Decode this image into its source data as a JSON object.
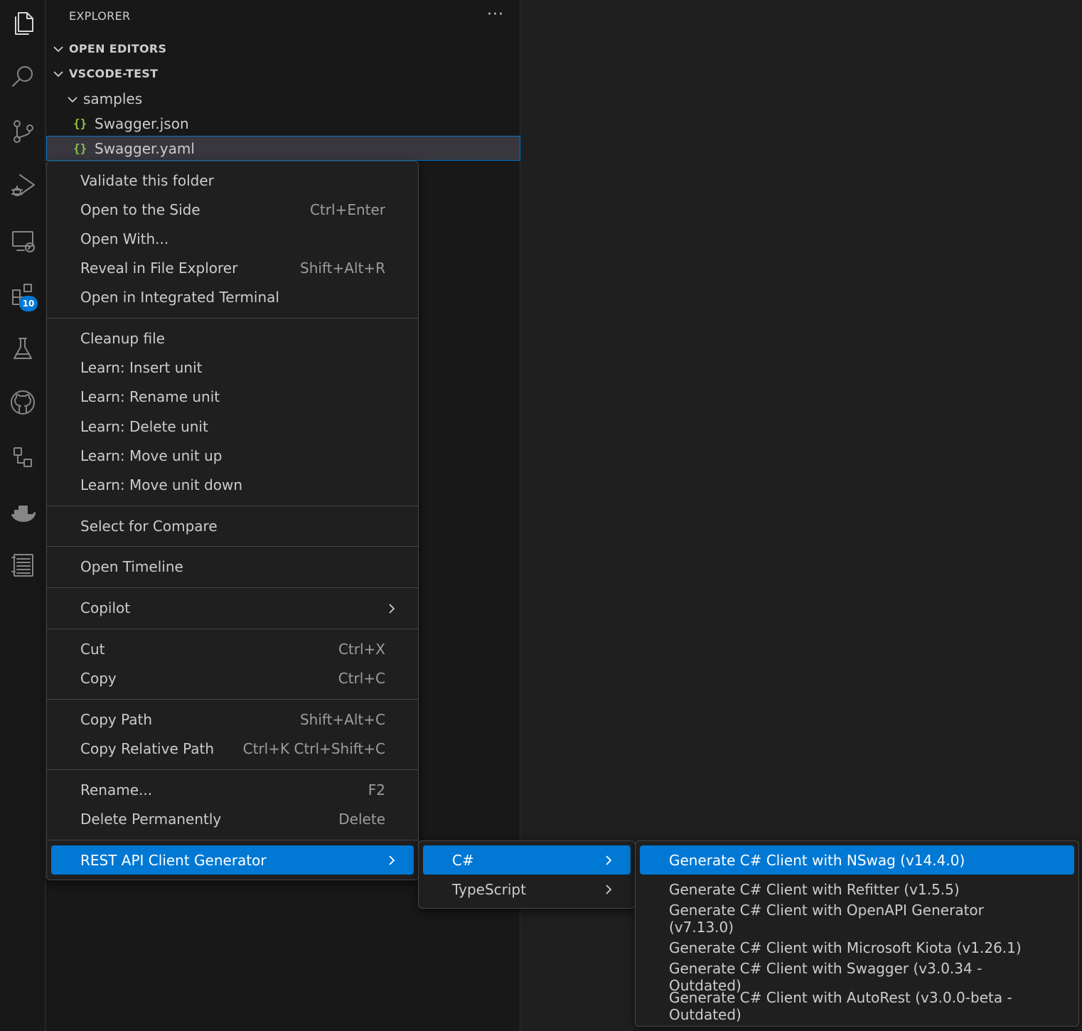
{
  "sidebar": {
    "title": "EXPLORER",
    "more": "···",
    "open_editors": "OPEN EDITORS",
    "workspace": "VSCODE-TEST",
    "folder": "samples",
    "files": [
      {
        "icon": "{}",
        "name": "Swagger.json"
      },
      {
        "icon": "{}",
        "name": "Swagger.yaml"
      }
    ]
  },
  "activity_bar": {
    "extensions_badge": "10"
  },
  "context_menu": {
    "groups": [
      [
        {
          "label": "Validate this folder",
          "shortcut": ""
        },
        {
          "label": "Open to the Side",
          "shortcut": "Ctrl+Enter"
        },
        {
          "label": "Open With...",
          "shortcut": ""
        },
        {
          "label": "Reveal in File Explorer",
          "shortcut": "Shift+Alt+R"
        },
        {
          "label": "Open in Integrated Terminal",
          "shortcut": ""
        }
      ],
      [
        {
          "label": "Cleanup file",
          "shortcut": ""
        },
        {
          "label": "Learn: Insert unit",
          "shortcut": ""
        },
        {
          "label": "Learn: Rename unit",
          "shortcut": ""
        },
        {
          "label": "Learn: Delete unit",
          "shortcut": ""
        },
        {
          "label": "Learn: Move unit up",
          "shortcut": ""
        },
        {
          "label": "Learn: Move unit down",
          "shortcut": ""
        }
      ],
      [
        {
          "label": "Select for Compare",
          "shortcut": ""
        }
      ],
      [
        {
          "label": "Open Timeline",
          "shortcut": ""
        }
      ],
      [
        {
          "label": "Copilot",
          "shortcut": ""
        }
      ],
      [
        {
          "label": "Cut",
          "shortcut": "Ctrl+X"
        },
        {
          "label": "Copy",
          "shortcut": "Ctrl+C"
        }
      ],
      [
        {
          "label": "Copy Path",
          "shortcut": "Shift+Alt+C"
        },
        {
          "label": "Copy Relative Path",
          "shortcut": "Ctrl+K Ctrl+Shift+C"
        }
      ],
      [
        {
          "label": "Rename...",
          "shortcut": "F2"
        },
        {
          "label": "Delete Permanently",
          "shortcut": "Delete"
        }
      ],
      [
        {
          "label": "REST API Client Generator",
          "shortcut": ""
        }
      ]
    ]
  },
  "submenu_language": {
    "items": [
      {
        "label": "C#"
      },
      {
        "label": "TypeScript"
      }
    ]
  },
  "submenu_csharp": {
    "items": [
      {
        "label": "Generate C# Client with NSwag (v14.4.0)"
      },
      {
        "label": "Generate C# Client with Refitter (v1.5.5)"
      },
      {
        "label": "Generate C# Client with OpenAPI Generator (v7.13.0)"
      },
      {
        "label": "Generate C# Client with Microsoft Kiota (v1.26.1)"
      },
      {
        "label": "Generate C# Client with Swagger (v3.0.34 - Outdated)"
      },
      {
        "label": "Generate C# Client with AutoRest (v3.0.0-beta - Outdated)"
      }
    ]
  },
  "colors": {
    "accent": "#0078d4",
    "json_icon": "#8bc34a",
    "background": "#1f1f1f",
    "sidebar": "#181818"
  }
}
